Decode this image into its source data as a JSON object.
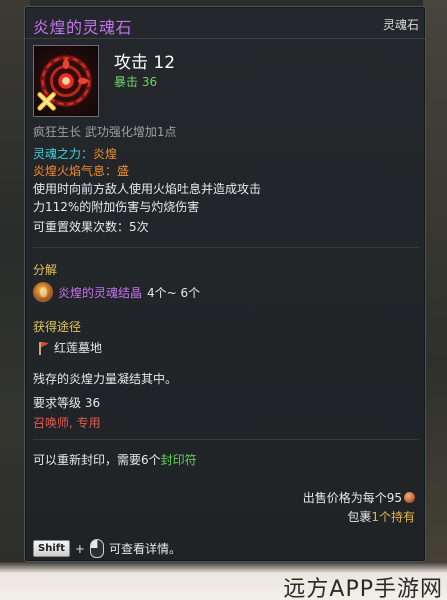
{
  "item": {
    "name": "炎煌的灵魂石",
    "type": "灵魂石",
    "main_stat": "攻击 12",
    "sub_stat": "暴击 36",
    "growth": "疯狂生长 武功强化增加1点"
  },
  "soul": {
    "power_label": "灵魂之力：",
    "power_value": "炎煌",
    "aura_label": "炎煌火焰气息：",
    "aura_value": "盛",
    "desc_line1": "使用时向前方敌人使用火焰吐息并造成攻击",
    "desc_line2": "力112%的附加伤害与灼烧伤害",
    "reset_count": "可重置效果次数：5次"
  },
  "decompose": {
    "heading": "分解",
    "result_name": "炎煌的灵魂结晶",
    "result_qty": "4个~ 6个"
  },
  "source": {
    "heading": "获得途径",
    "location": "红莲墓地"
  },
  "flavor": "残存的炎煌力量凝结其中。",
  "requirement": {
    "level": "要求等级 36",
    "class": "召唤师, 专用"
  },
  "reseal": {
    "text": "可以重新封印，需要6个",
    "item": "封印符"
  },
  "price": {
    "label": "出售价格为每个95",
    "bag_prefix": "包裹",
    "bag_count": "1个持有"
  },
  "hint": {
    "shift_key": "Shift",
    "plus": "+",
    "text": "可查看详情。"
  },
  "watermark": "远方APP手游网",
  "colors": {
    "title": "#c673ef",
    "stat_green": "#63d45b",
    "soul_cyan": "#3fd3e3",
    "aura_orange": "#ef8c2e",
    "section_yellow": "#e6c55a",
    "class_red": "#e05a4f"
  },
  "icons": {
    "item_icon": "soul-stone-icon",
    "crystal": "soul-crystal-icon",
    "location": "red-flag-icon",
    "coin": "copper-coin-icon",
    "mouse": "mouse-icon"
  }
}
